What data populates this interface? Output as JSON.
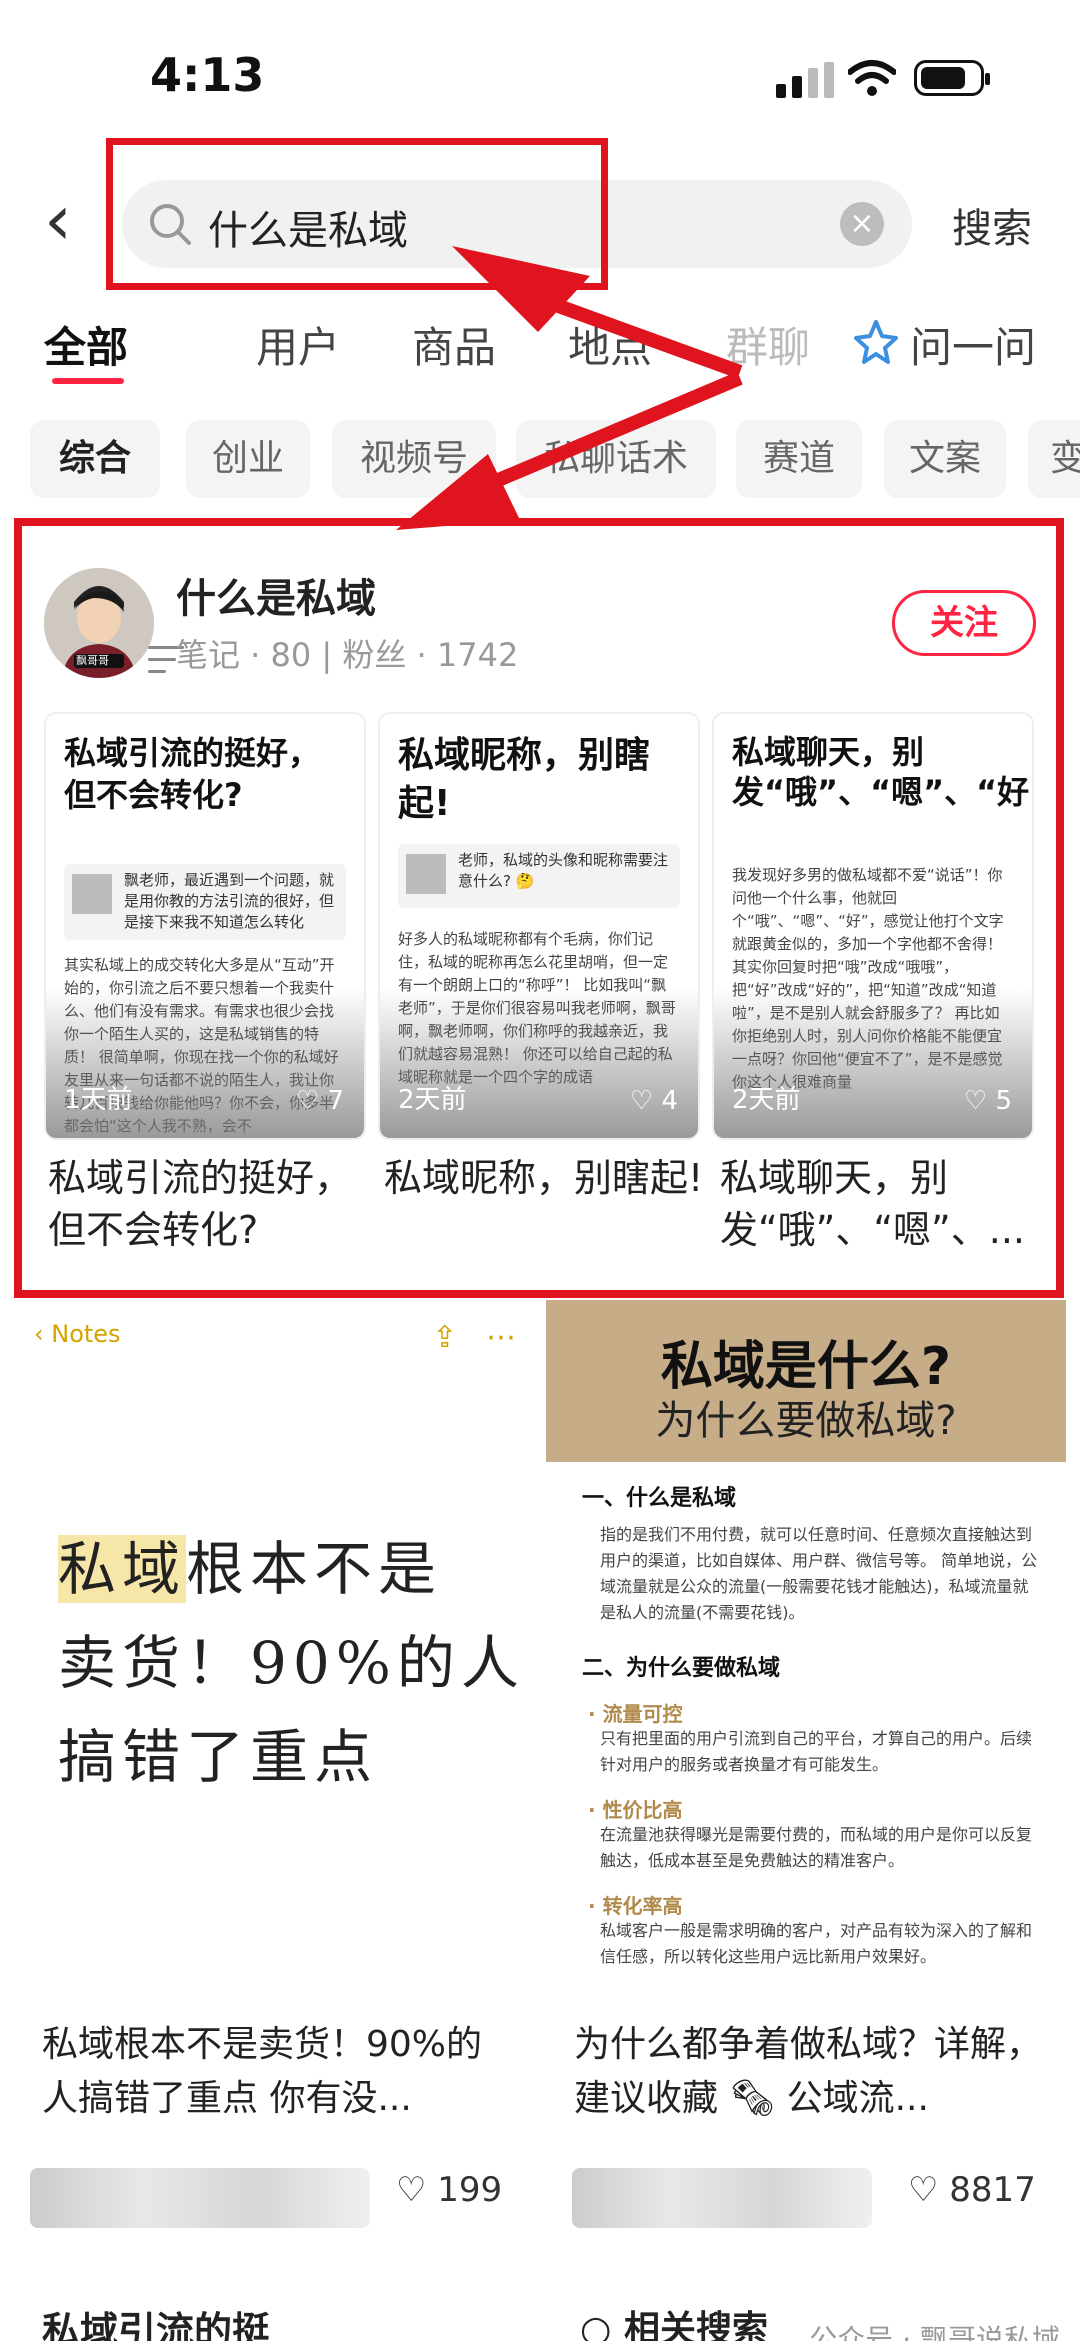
{
  "status_bar": {
    "time": "4:13"
  },
  "search": {
    "query": "什么是私域",
    "clear_symbol": "×",
    "submit_label": "搜索"
  },
  "tabs": [
    {
      "label": "全部"
    },
    {
      "label": "用户"
    },
    {
      "label": "商品"
    },
    {
      "label": "地点"
    },
    {
      "label": "群聊"
    },
    {
      "label": "问一问"
    }
  ],
  "chips": [
    "综合",
    "创业",
    "视频号",
    "私聊话术",
    "赛道",
    "文案",
    "变"
  ],
  "user_card": {
    "name": "什么是私域",
    "stats": "笔记 · 80 | 粉丝 · 1742",
    "follow_label": "关注",
    "avatar_caption": "飘哥哥",
    "notes": [
      {
        "cover_title": "私域引流的挺好，但不会转化?",
        "quote": "飘老师，最近遇到一个问题，就是用你教的方法引流的很好，但是接下来我不知道怎么转化",
        "body": "其实私域上的成交转化大多是从“互动”开始的，你引流之后不要只想着一个我卖什么、他们有没有需求。有需求也很少会找你一个陌生人买的，这是私域销售的特质！ 很简单啊，你现在找一个你的私域好友里从来一句话都不说的陌生人，我让你转几百块钱给你能他吗？你不会，你多半都会怕“这个人我不熟，会不",
        "age": "1天前",
        "likes": "7",
        "title": "私域引流的挺好，但不会转化?"
      },
      {
        "cover_title": "私域昵称，别瞎起!",
        "quote": "老师，私域的头像和昵称需要注意什么? 🤔",
        "body": "好多人的私域昵称都有个毛病，你们记住，私域的昵称再怎么花里胡哨，但一定有一个朗朗上口的“称呼”！ 比如我叫“飘老师”，于是你们很容易叫我老师啊，飘哥啊，飘老师啊，你们称呼的我越亲近，我们就越容易混熟！ 你还可以给自己起的私域昵称就是一个四个字的成语",
        "age": "2天前",
        "likes": "4",
        "title": "私域昵称，别瞎起!"
      },
      {
        "cover_title": "私域聊天，别发“哦”、“嗯”、“好”",
        "quote": "",
        "body": "我发现好多男的做私域都不爱“说话”！你问他一个什么事，他就回个“哦”、“嗯”、“好”，感觉让他打个文字就跟黄金似的，多加一个字他都不舍得！ 其实你回复时把“哦”改成“哦哦”，把“好”改成“好的”，把“知道”改成“知道啦”，是不是别人就会舒服多了？ 再比如你拒绝别人时，别人问你价格能不能便宜一点呀？你回他“便宜不了”，是不是感觉你这个人很难商量",
        "age": "2天前",
        "likes": "5",
        "title": "私域聊天，别发“哦”、“嗯”、..."
      }
    ]
  },
  "feed": [
    {
      "app_bar": "Notes",
      "handwriting_lines": [
        "私域根本不是",
        "卖货！90%的人",
        "搞错了重点"
      ],
      "highlight": "私域",
      "title": "私域根本不是卖货！90%的人搞错了重点 你有没...",
      "likes": "199"
    },
    {
      "cover_title": "私域是什么?",
      "cover_subtitle": "为什么要做私域?",
      "sections": [
        {
          "heading": "一、什么是私域",
          "text": "指的是我们不用付费，就可以任意时间、任意频次直接触达到用户的渠道，比如自媒体、用户群、微信号等。 简单地说，公域流量就是公众的流量(一般需要花钱才能触达)，私域流量就是私人的流量(不需要花钱)。"
        },
        {
          "heading": "二、为什么要做私域",
          "text": ""
        }
      ],
      "bullets": [
        {
          "label": "流量可控",
          "text": "只有把里面的用户引流到自己的平台，才算自己的用户。后续针对用户的服务或者换量才有可能发生。"
        },
        {
          "label": "性价比高",
          "text": "在流量池获得曝光是需要付费的，而私域的用户是你可以反复触达，低成本甚至是免费触达的精准客户。"
        },
        {
          "label": "转化率高",
          "text": "私域客户一般是需求明确的客户，对产品有较为深入的了解和信任感，所以转化这些用户远比新用户效果好。"
        }
      ],
      "title": "为什么都争着做私域？详解，建议收藏 🗞 公域流...",
      "likes": "8817"
    }
  ],
  "bottom": {
    "left_title": "私域引流的挺",
    "right_title": "相关搜索",
    "watermark": "公众号 · 飘哥说私域"
  }
}
